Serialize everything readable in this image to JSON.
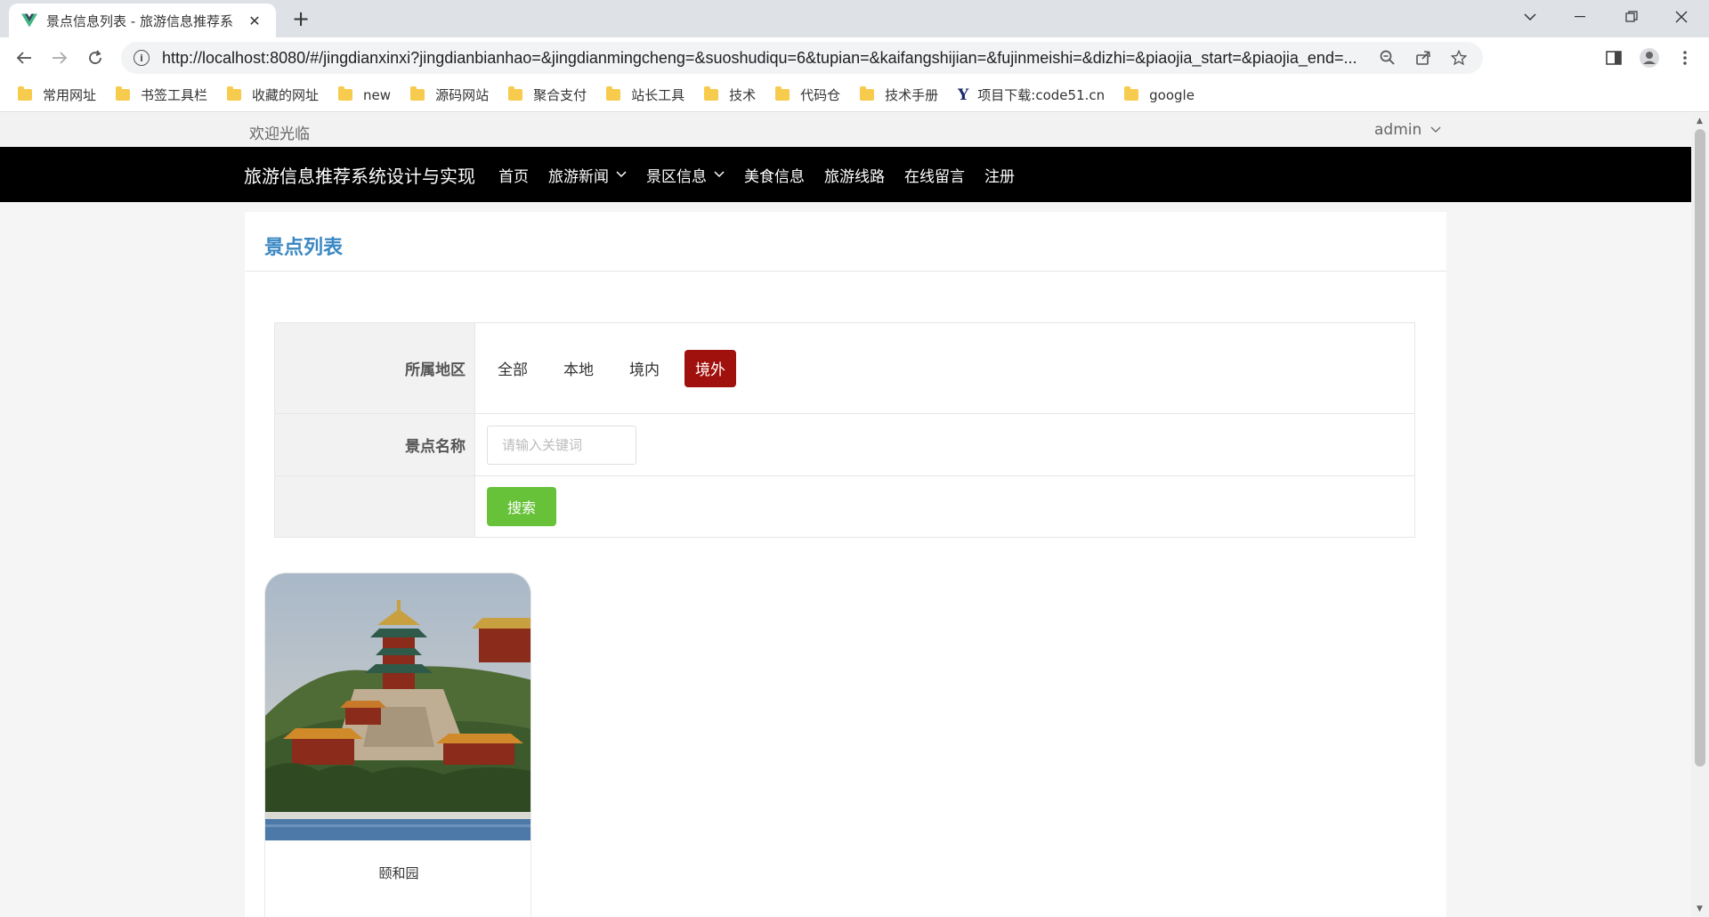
{
  "browser": {
    "tab_title": "景点信息列表 - 旅游信息推荐系",
    "url": "http://localhost:8080/#/jingdianxinxi?jingdianbianhao=&jingdianmingcheng=&suoshudiqu=6&tupian=&kaifangshijian=&fujinmeishi=&dizhi=&piaojia_start=&piaojia_end=...",
    "bookmarks": [
      "常用网址",
      "书签工具栏",
      "收藏的网址",
      "new",
      "源码网站",
      "聚合支付",
      "站长工具",
      "技术",
      "代码仓",
      "技术手册",
      "项目下载:code51.cn",
      "google"
    ]
  },
  "topbar": {
    "welcome": "欢迎光临",
    "user": "admin"
  },
  "navbar": {
    "site_title": "旅游信息推荐系统设计与实现",
    "menu": [
      {
        "label": "首页"
      },
      {
        "label": "旅游新闻"
      },
      {
        "label": "景区信息"
      },
      {
        "label": "美食信息"
      },
      {
        "label": "旅游线路"
      },
      {
        "label": "在线留言"
      },
      {
        "label": "注册"
      }
    ]
  },
  "panel": {
    "title": "景点列表"
  },
  "filter": {
    "region_label": "所属地区",
    "regions": [
      "全部",
      "本地",
      "境内",
      "境外"
    ],
    "active_region": "境外",
    "name_label": "景点名称",
    "name_placeholder": "请输入关键词",
    "search_button": "搜索"
  },
  "cards": [
    {
      "name": "颐和园"
    }
  ],
  "colors": {
    "nav_bg": "#000000",
    "title_blue": "#3b88c3",
    "active_red": "#a0100c",
    "search_green": "#67c23a"
  }
}
